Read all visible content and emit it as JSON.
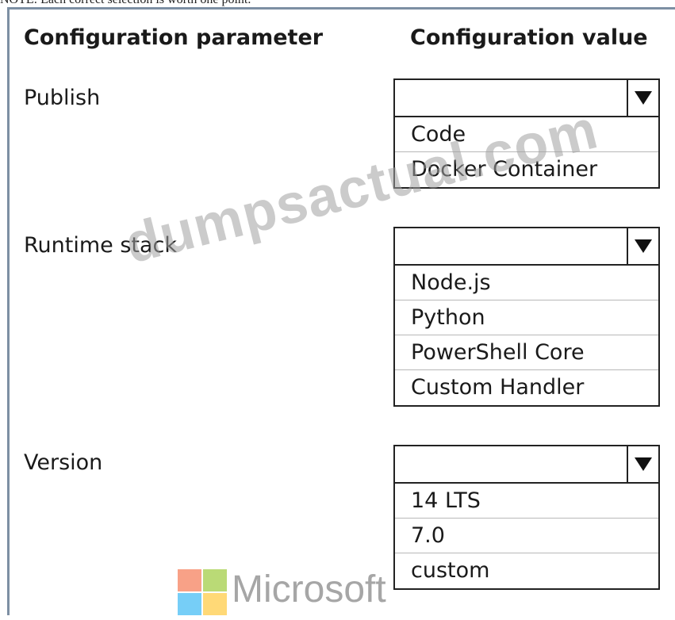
{
  "note": "NOTE: Each correct selection is worth one point.",
  "headers": {
    "parameter": "Configuration parameter",
    "value": "Configuration value"
  },
  "rows": [
    {
      "label": "Publish",
      "selected": "",
      "options": [
        "Code",
        "Docker Container"
      ]
    },
    {
      "label": "Runtime stack",
      "selected": "",
      "options": [
        "Node.js",
        "Python",
        "PowerShell Core",
        "Custom Handler"
      ]
    },
    {
      "label": "Version",
      "selected": "",
      "options": [
        "14 LTS",
        "7.0",
        "custom"
      ]
    }
  ],
  "watermark": "dumpsactual.com",
  "brand": {
    "name": "Microsoft",
    "colors": [
      "#f35325",
      "#81bc06",
      "#05a6f0",
      "#ffba08"
    ]
  },
  "icons": {
    "dropdown": "triangle-down-icon",
    "logo": "microsoft-logo-icon"
  }
}
